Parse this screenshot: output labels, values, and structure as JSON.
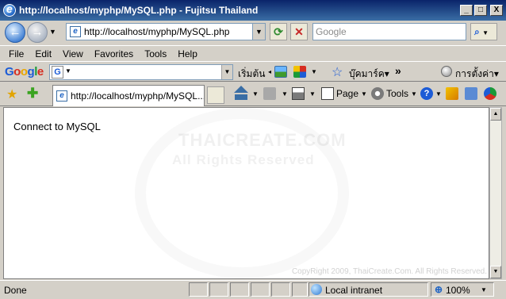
{
  "window": {
    "title": "http://localhost/myphp/MySQL.php - Fujitsu Thailand",
    "minimize_glyph": "_",
    "maximize_glyph": "□",
    "close_glyph": "X"
  },
  "navigation": {
    "back_glyph": "←",
    "forward_glyph": "→",
    "address_value": "http://localhost/myphp/MySQL.php",
    "refresh_glyph": "⟳",
    "stop_glyph": "✕",
    "search_placeholder": "Google",
    "search_button_glyph": "⌕"
  },
  "menu": {
    "items": [
      "File",
      "Edit",
      "View",
      "Favorites",
      "Tools",
      "Help"
    ]
  },
  "google_toolbar": {
    "logo": [
      "G",
      "o",
      "o",
      "g",
      "l",
      "e"
    ],
    "search_button_label": "เริ่มต้น",
    "bookmarks_label": "บุ๊คมาร์ค▾",
    "more_glyph": "»",
    "settings_label": "การตั้งค่า▾"
  },
  "tabs": {
    "active_tab_label": "http://localhost/myphp/MySQL...."
  },
  "command_bar": {
    "page_label": "Page",
    "tools_label": "Tools",
    "help_glyph": "?"
  },
  "content": {
    "message": "Connect to MySQL",
    "watermark_line1": "THAICREATE.COM",
    "watermark_line2": "All Rights Reserved",
    "copyright": "CopyRight 2009, ThaiCreate.Com. All Rights Reserved."
  },
  "status_bar": {
    "status_text": "Done",
    "zone_label": "Local intranet",
    "zoom_label": "100%"
  },
  "colors": {
    "titlebar_start": "#0a246a",
    "titlebar_end": "#3a6ea5",
    "chrome": "#d4d0c8"
  }
}
